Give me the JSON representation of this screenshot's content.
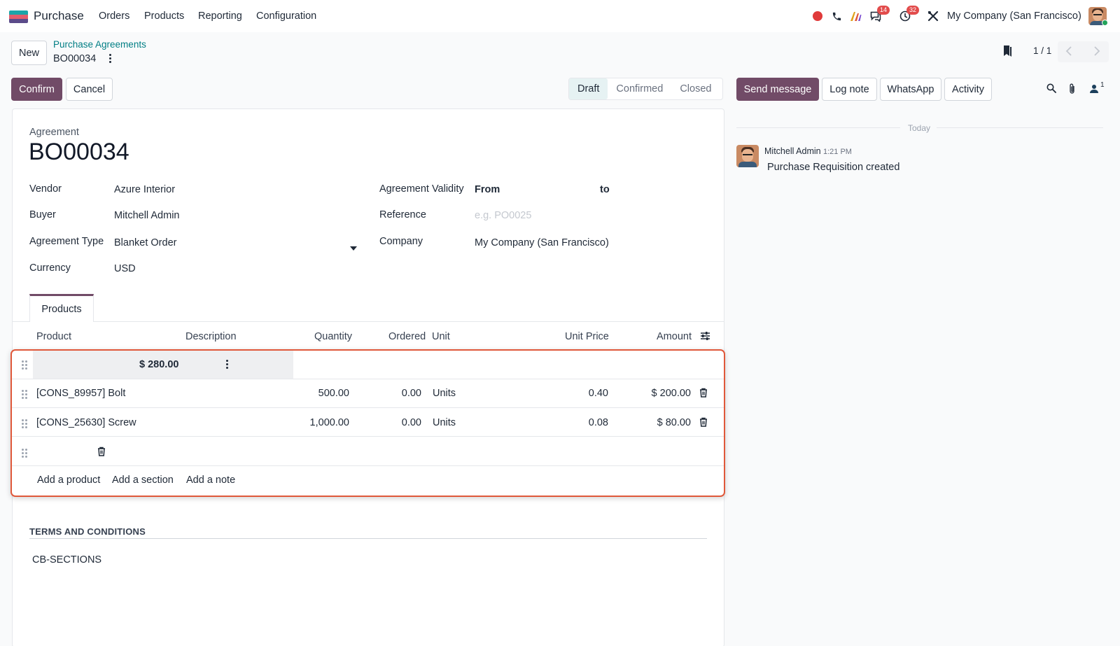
{
  "topbar": {
    "app_name": "Purchase",
    "menu": [
      "Orders",
      "Products",
      "Reporting",
      "Configuration"
    ],
    "messages_badge": "14",
    "activities_badge": "32",
    "company": "My Company (San Francisco)"
  },
  "control": {
    "new_label": "New",
    "breadcrumb_parent": "Purchase Agreements",
    "breadcrumb_current": "BO00034",
    "pager": "1 / 1",
    "confirm_label": "Confirm",
    "cancel_label": "Cancel",
    "statuses": [
      "Draft",
      "Confirmed",
      "Closed"
    ]
  },
  "form": {
    "subtitle": "Agreement",
    "title": "BO00034",
    "vendor_label": "Vendor",
    "vendor": "Azure Interior",
    "buyer_label": "Buyer",
    "buyer": "Mitchell Admin",
    "type_label": "Agreement Type",
    "type": "Blanket Order",
    "currency_label": "Currency",
    "currency": "USD",
    "validity_label": "Agreement Validity",
    "from_label": "From",
    "to_label": "to",
    "reference_label": "Reference",
    "reference_placeholder": "e.g. PO0025",
    "company_label": "Company",
    "company": "My Company (San Francisco)"
  },
  "tabs": [
    "Products"
  ],
  "table": {
    "headers": [
      "Product",
      "Description",
      "Quantity",
      "Ordered",
      "Unit",
      "Unit Price",
      "Amount"
    ],
    "section_total": "$ 280.00",
    "rows": [
      {
        "product": "[CONS_89957] Bolt",
        "quantity": "500.00",
        "ordered": "0.00",
        "unit": "Units",
        "unit_price": "0.40",
        "amount": "$ 200.00"
      },
      {
        "product": "[CONS_25630] Screw",
        "quantity": "1,000.00",
        "ordered": "0.00",
        "unit": "Units",
        "unit_price": "0.08",
        "amount": "$ 80.00"
      }
    ],
    "add_product": "Add a product",
    "add_section": "Add a section",
    "add_note": "Add a note"
  },
  "terms": {
    "heading": "TERMS AND CONDITIONS",
    "text": "CB-SECTIONS"
  },
  "chatter": {
    "send_message": "Send message",
    "log_note": "Log note",
    "whatsapp": "WhatsApp",
    "activity": "Activity",
    "followers_count": "1",
    "date_divider": "Today",
    "author": "Mitchell Admin",
    "time": "1:21 PM",
    "message": "Purchase Requisition created"
  },
  "colors": {
    "brand": "#714b67",
    "link": "#017e84",
    "highlight": "#e0583a"
  }
}
